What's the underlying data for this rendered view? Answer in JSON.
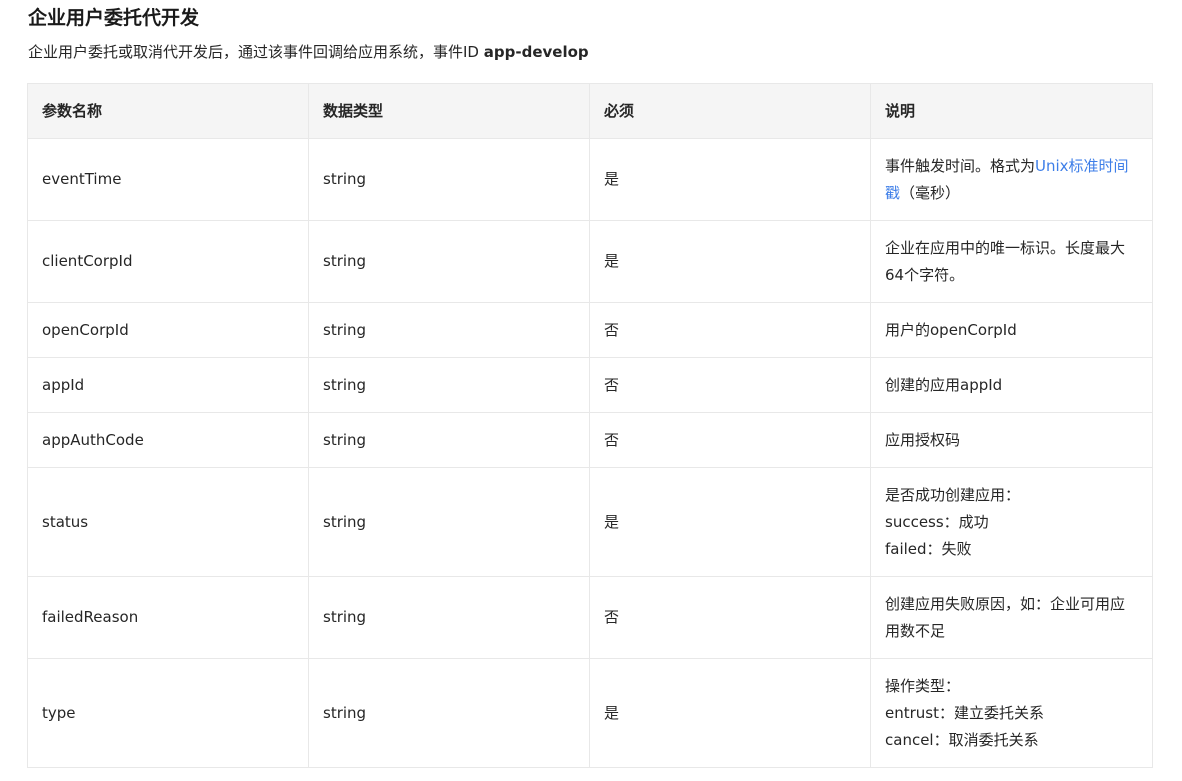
{
  "section": {
    "title": "企业用户委托代开发",
    "description": "企业用户委托或取消代开发后，通过该事件回调给应用系统，事件ID",
    "event_id": "app-develop"
  },
  "table": {
    "headers": [
      "参数名称",
      "数据类型",
      "必须",
      "说明"
    ],
    "rows": [
      {
        "name": "eventTime",
        "type": "string",
        "required": "是",
        "desc_prefix": "事件触发时间。格式为",
        "desc_link": "Unix标准时间戳",
        "desc_suffix": "（毫秒）"
      },
      {
        "name": "clientCorpId",
        "type": "string",
        "required": "是",
        "desc": "企业在应用中的唯一标识。长度最大64个字符。"
      },
      {
        "name": "openCorpId",
        "type": "string",
        "required": "否",
        "desc": "用户的openCorpId"
      },
      {
        "name": "appId",
        "type": "string",
        "required": "否",
        "desc": "创建的应用appId"
      },
      {
        "name": "appAuthCode",
        "type": "string",
        "required": "否",
        "desc": "应用授权码"
      },
      {
        "name": "status",
        "type": "string",
        "required": "是",
        "desc_lines": [
          "是否成功创建应用：",
          "success：成功",
          "failed：失败"
        ]
      },
      {
        "name": "failedReason",
        "type": "string",
        "required": "否",
        "desc": "创建应用失败原因，如：企业可用应用数不足"
      },
      {
        "name": "type",
        "type": "string",
        "required": "是",
        "desc_lines": [
          "操作类型：",
          "entrust：建立委托关系",
          "cancel：取消委托关系"
        ]
      }
    ]
  }
}
